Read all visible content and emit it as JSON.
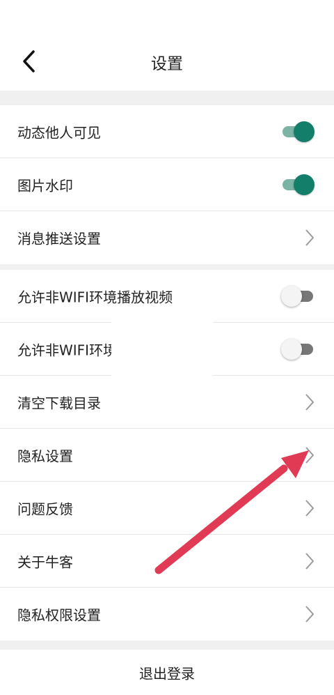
{
  "header": {
    "title": "设置",
    "back_icon": "chevron-left-icon"
  },
  "settings": {
    "moments_visible": {
      "label": "动态他人可见",
      "enabled": true
    },
    "image_watermark": {
      "label": "图片水印",
      "enabled": true
    },
    "push_settings": {
      "label": "消息推送设置"
    },
    "allow_non_wifi_play": {
      "label": "允许非WIFI环境播放视频",
      "enabled": false
    },
    "allow_non_wifi_download": {
      "label": "允许非WIFI环境",
      "enabled": false
    },
    "clear_download_dir": {
      "label": "清空下载目录"
    },
    "privacy": {
      "label": "隐私设置"
    },
    "feedback": {
      "label": "问题反馈"
    },
    "about": {
      "label": "关于牛客"
    },
    "privacy_permissions": {
      "label": "隐私权限设置"
    }
  },
  "logout": {
    "label": "退出登录"
  },
  "colors": {
    "toggle_on_knob": "#137f6a",
    "toggle_on_track": "#7bb3a4",
    "toggle_off_track": "#777777",
    "annotation_arrow": "#e03a55",
    "section_gap": "#f0f0f0"
  }
}
